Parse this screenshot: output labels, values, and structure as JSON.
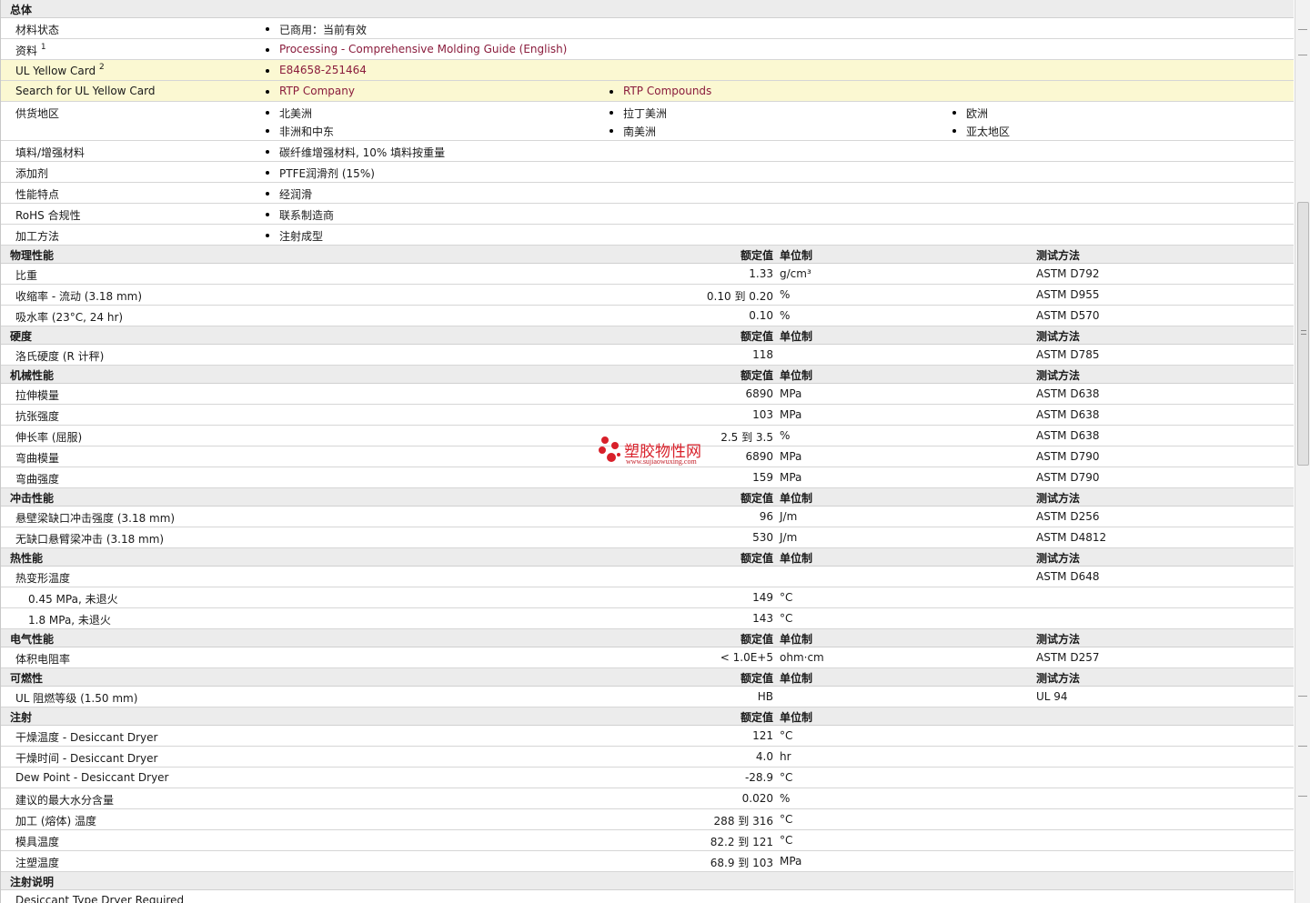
{
  "general": {
    "title": "总体",
    "material_status": {
      "label": "材料状态",
      "value": "已商用：当前有效"
    },
    "documents": {
      "label": "资料",
      "sup": "1",
      "value": "Processing - Comprehensive Molding Guide (English)"
    },
    "yellow_card": {
      "label": "UL Yellow Card",
      "sup": "2",
      "value": "E84658-251464"
    },
    "search_yellow": {
      "label": "Search for UL Yellow Card",
      "values": [
        "RTP Company",
        "RTP Compounds"
      ]
    },
    "regions": {
      "label": "供货地区",
      "values": [
        "北美洲",
        "拉丁美洲",
        "欧洲",
        "非洲和中东",
        "南美洲",
        "亚太地区"
      ]
    },
    "filler": {
      "label": "填料/增强材料",
      "value": "碳纤维增强材料, 10% 填料按重量"
    },
    "additive": {
      "label": "添加剂",
      "value": "PTFE润滑剂 (15%)"
    },
    "features": {
      "label": "性能特点",
      "value": "经润滑"
    },
    "rohs": {
      "label": "RoHS 合规性",
      "value": "联系制造商"
    },
    "processing": {
      "label": "加工方法",
      "value": "注射成型"
    }
  },
  "headers": {
    "nominal": "额定值",
    "unit": "单位制",
    "method": "测试方法"
  },
  "sections": [
    {
      "title": "物理性能",
      "show_method": true,
      "rows": [
        {
          "label": "比重",
          "value": "1.33",
          "unit": "g/cm³",
          "method": "ASTM D792"
        },
        {
          "label": "收缩率 - 流动 (3.18 mm)",
          "value": "0.10 到  0.20",
          "unit": "%",
          "method": "ASTM D955"
        },
        {
          "label": "吸水率 (23°C, 24 hr)",
          "value": "0.10",
          "unit": "%",
          "method": "ASTM D570"
        }
      ]
    },
    {
      "title": "硬度",
      "show_method": true,
      "rows": [
        {
          "label": "洛氏硬度 (R 计秤)",
          "value": "118",
          "unit": "",
          "method": "ASTM D785"
        }
      ]
    },
    {
      "title": "机械性能",
      "show_method": true,
      "rows": [
        {
          "label": "拉伸模量",
          "value": "6890",
          "unit": "MPa",
          "method": "ASTM D638"
        },
        {
          "label": "抗张强度",
          "value": "103",
          "unit": "MPa",
          "method": "ASTM D638"
        },
        {
          "label": "伸长率 (屈服)",
          "value": "2.5 到  3.5",
          "unit": "%",
          "method": "ASTM D638"
        },
        {
          "label": "弯曲模量",
          "value": "6890",
          "unit": "MPa",
          "method": "ASTM D790"
        },
        {
          "label": "弯曲强度",
          "value": "159",
          "unit": "MPa",
          "method": "ASTM D790"
        }
      ]
    },
    {
      "title": "冲击性能",
      "show_method": true,
      "rows": [
        {
          "label": "悬壁梁缺口冲击强度 (3.18 mm)",
          "value": "96",
          "unit": "J/m",
          "method": "ASTM D256"
        },
        {
          "label": "无缺口悬臂梁冲击 (3.18 mm)",
          "value": "530",
          "unit": "J/m",
          "method": "ASTM D4812"
        }
      ]
    },
    {
      "title": "热性能",
      "show_method": true,
      "rows": [
        {
          "label": "热变形温度",
          "value": "",
          "unit": "",
          "method": "ASTM D648"
        },
        {
          "label": "0.45 MPa, 未退火",
          "value": "149",
          "unit": "°C",
          "method": "",
          "indent": true
        },
        {
          "label": "1.8 MPa, 未退火",
          "value": "143",
          "unit": "°C",
          "method": "",
          "indent": true
        }
      ]
    },
    {
      "title": "电气性能",
      "show_method": true,
      "rows": [
        {
          "label": "体积电阻率",
          "value": "< 1.0E+5",
          "unit": "ohm·cm",
          "method": "ASTM D257"
        }
      ]
    },
    {
      "title": "可燃性",
      "show_method": true,
      "rows": [
        {
          "label": "UL 阻燃等级 (1.50 mm)",
          "value": "HB",
          "unit": "",
          "method": "UL 94"
        }
      ]
    },
    {
      "title": "注射",
      "show_method": false,
      "rows": [
        {
          "label": "干燥温度 - Desiccant Dryer",
          "value": "121",
          "unit": "°C",
          "method": ""
        },
        {
          "label": "干燥时间 - Desiccant Dryer",
          "value": "4.0",
          "unit": "hr",
          "method": ""
        },
        {
          "label": "Dew Point - Desiccant Dryer",
          "value": "-28.9",
          "unit": "°C",
          "method": ""
        },
        {
          "label": "建议的最大水分含量",
          "value": "0.020",
          "unit": "%",
          "method": ""
        },
        {
          "label": "加工 (熔体) 温度",
          "value": "288 到  316",
          "unit": "°C",
          "method": ""
        },
        {
          "label": "模具温度",
          "value": "82.2 到  121",
          "unit": "°C",
          "method": ""
        },
        {
          "label": "注塑温度",
          "value": "68.9 到  103",
          "unit": "MPa",
          "method": ""
        }
      ]
    },
    {
      "title": "注射说明",
      "show_method": false,
      "hide_headers": true,
      "rows": [
        {
          "label": "Desiccant Type Dryer Required",
          "value": "",
          "unit": "",
          "method": ""
        }
      ]
    }
  ],
  "watermark": {
    "text": "塑胶物性网",
    "url": "www.sujiaowuxing.com"
  },
  "colors": {
    "link": "#8a1c3c",
    "highlight": "#fbf8d2",
    "section_bg": "#ececec",
    "watermark": "#d8202a"
  }
}
